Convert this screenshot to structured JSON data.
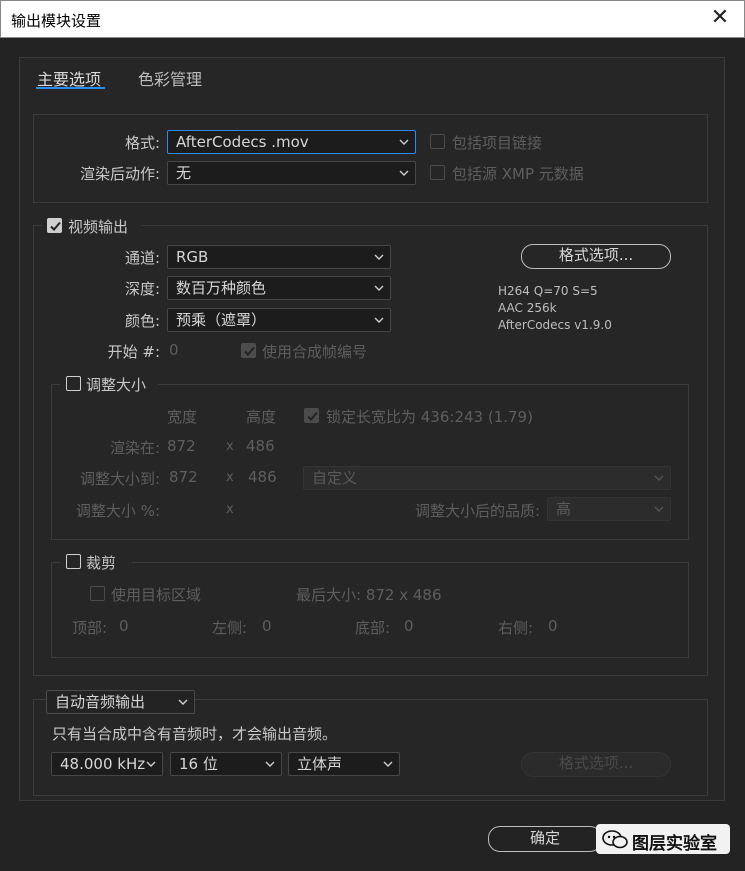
{
  "window": {
    "title": "输出模块设置",
    "close_glyph": "✕"
  },
  "tabs": {
    "main": "主要选项",
    "color": "色彩管理"
  },
  "format": {
    "label": "格式:",
    "value": "AfterCodecs .mov",
    "post_label": "渲染后动作:",
    "post_value": "无",
    "include_link": "包括项目链接",
    "include_xmp": "包括源 XMP 元数据"
  },
  "video": {
    "checkbox_label": "视频输出",
    "channels_label": "通道:",
    "channels_value": "RGB",
    "depth_label": "深度:",
    "depth_value": "数百万种颜色",
    "color_label": "颜色:",
    "color_value": "预乘（遮罩）",
    "start_label": "开始 #:",
    "start_value": "0",
    "use_comp_frame": "使用合成帧编号",
    "format_options_button": "格式选项...",
    "codec_info": [
      "H264 Q=70 S=5",
      "AAC 256k",
      "AfterCodecs v1.9.0"
    ]
  },
  "resize": {
    "title": "调整大小",
    "width_header": "宽度",
    "height_header": "高度",
    "lock_aspect": "锁定长宽比为 436:243 (1.79)",
    "render_at_label": "渲染在:",
    "render_w": "872",
    "render_x": "x",
    "render_h": "486",
    "resize_to_label": "调整大小到:",
    "to_w": "872",
    "to_x": "x",
    "to_h": "486",
    "preset_value": "自定义",
    "percent_label": "调整大小 %:",
    "percent_x": "x",
    "quality_label": "调整大小后的品质:",
    "quality_value": "高"
  },
  "crop": {
    "title": "裁剪",
    "use_roi": "使用目标区域",
    "final_size": "最后大小: 872 x 486",
    "top_label": "顶部:",
    "top_value": "0",
    "left_label": "左侧:",
    "left_value": "0",
    "bottom_label": "底部:",
    "bottom_value": "0",
    "right_label": "右侧:",
    "right_value": "0"
  },
  "audio": {
    "mode_value": "自动音频输出",
    "note": "只有当合成中含有音频时，才会输出音频。",
    "rate_value": "48.000 kHz",
    "bits_value": "16 位",
    "channels_value": "立体声",
    "format_options_button": "格式选项..."
  },
  "footer": {
    "ok_button": "确定",
    "watermark_text": "图层实验室"
  },
  "colors": {
    "accent": "#2d8ceb",
    "background": "#232323",
    "text": "#c8c8c8",
    "disabled": "#5e5e5e"
  }
}
